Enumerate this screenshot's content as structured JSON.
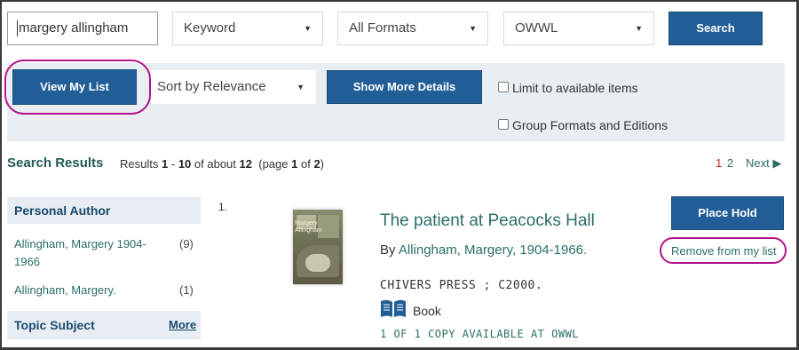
{
  "search": {
    "query": "margery allingham",
    "type": "Keyword",
    "format": "All Formats",
    "library": "OWWL",
    "button_label": "Search"
  },
  "toolbar": {
    "view_list_label": "View My List",
    "sort_label": "Sort by Relevance",
    "details_label": "Show More Details",
    "limit_available_label": "Limit to available items",
    "group_formats_label": "Group Formats and Editions"
  },
  "results": {
    "heading": "Search Results",
    "prefix": "Results",
    "from": "1",
    "dash": "-",
    "to": "10",
    "of_about": "of about",
    "total": "12",
    "page_prefix": "(page",
    "page": "1",
    "page_of": "of",
    "pages": "2",
    "page_suffix": ")",
    "pagination": {
      "current": "1",
      "other": "2",
      "next_label": "Next ▶"
    }
  },
  "facets": [
    {
      "heading": "Personal Author",
      "items": [
        {
          "label_line1": "Allingham, Margery 1904-",
          "label_line2": "1966",
          "count": "(9)"
        },
        {
          "label_line1": "Allingham, Margery.",
          "label_line2": "",
          "count": "(1)"
        }
      ]
    },
    {
      "heading": "Topic Subject",
      "more_label": "More"
    }
  ],
  "record": {
    "number": "1.",
    "title": "The patient at Peacocks Hall",
    "author_prefix": "By",
    "author": "Allingham, Margery, 1904-1966.",
    "publisher": "CHIVERS PRESS ; C2000.",
    "format_icon": "open-book-icon",
    "format": "Book",
    "availability": "1 OF 1 COPY AVAILABLE AT OWWL",
    "place_hold_label": "Place Hold",
    "remove_label": "Remove from my list",
    "cover_text_line1": "Margery",
    "cover_text_line2": "Allingham"
  },
  "colors": {
    "primary_button": "#215d96",
    "link_green": "#2a6f66",
    "highlight_ring": "#b5138b",
    "toolbar_bg": "#e9eef3",
    "current_page_red": "#c0282d"
  }
}
